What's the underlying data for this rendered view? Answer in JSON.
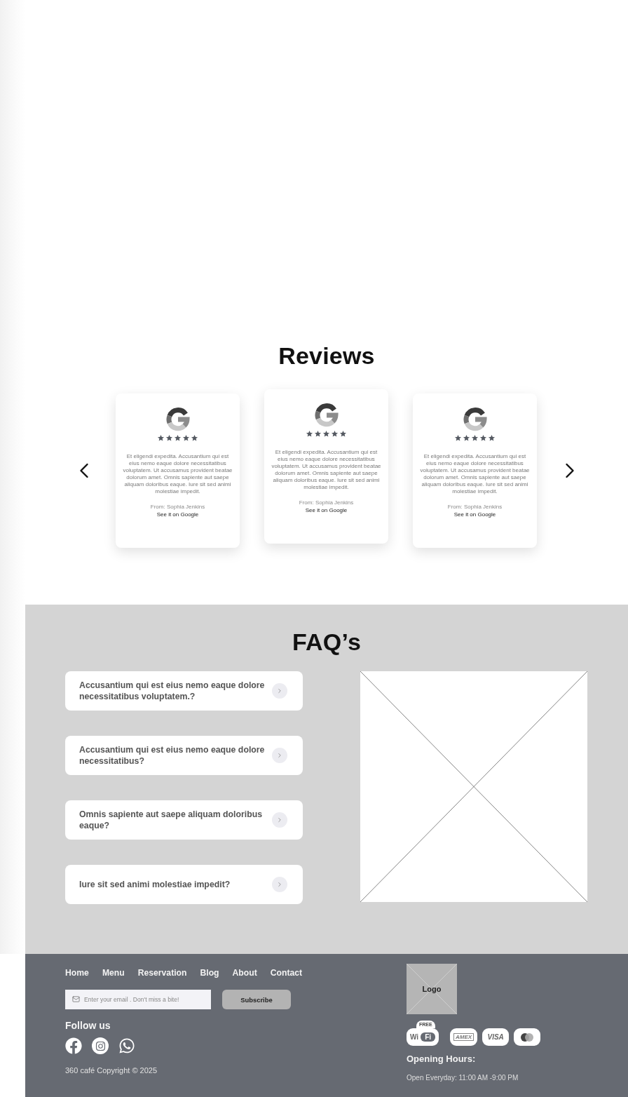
{
  "reviews": {
    "title": "Reviews",
    "cards": [
      {
        "stars": 5,
        "text": "Et eligendi expedita. Accusantium qui est eius nemo eaque dolore necessitatibus voluptatem. Ut accusamus provident beatae dolorum amet. Omnis sapiente aut saepe aliquam doloribus eaque. Iure sit sed animi molestiae impedit.",
        "author": "From: Sophia Jenkins",
        "link": "See it on Google"
      },
      {
        "stars": 5,
        "text": "Et eligendi expedita. Accusantium qui est eius nemo eaque dolore necessitatibus voluptatem. Ut accusamus provident beatae dolorum amet. Omnis sapiente aut saepe aliquam doloribus eaque. Iure sit sed animi molestiae impedit.",
        "author": "From: Sophia Jenkins",
        "link": "See it on Google"
      },
      {
        "stars": 5,
        "text": "Et eligendi expedita. Accusantium qui est eius nemo eaque dolore necessitatibus voluptatem. Ut accusamus provident beatae dolorum amet. Omnis sapiente aut saepe aliquam doloribus eaque. Iure sit sed animi molestiae impedit.",
        "author": "From: Sophia Jenkins",
        "link": "See it on Google"
      }
    ]
  },
  "faq": {
    "title": "FAQ’s",
    "items": [
      {
        "question": "Accusantium qui est eius nemo eaque dolore necessitatibus voluptatem.?"
      },
      {
        "question": "Accusantium qui est eius nemo eaque dolore necessitatibus?"
      },
      {
        "question": "Omnis sapiente aut saepe aliquam doloribus eaque?"
      },
      {
        "question": "Iure sit sed animi molestiae impedit?"
      }
    ]
  },
  "footer": {
    "nav": [
      "Home",
      "Menu",
      "Reservation",
      "Blog",
      "About",
      "Contact"
    ],
    "email": {
      "placeholder": "Enter your email . Don't miss a bite!"
    },
    "subscribe": "Subscribe",
    "follow_title": "Follow us",
    "copyright": "360 café Copyright © 2025",
    "logo": "Logo",
    "badges": [
      {
        "kind": "wifi",
        "top": "FREE",
        "left": "Wi",
        "right": "Fi"
      },
      {
        "kind": "card",
        "label": "AMEX"
      },
      {
        "kind": "card",
        "label": "VISA"
      },
      {
        "kind": "mastercard"
      }
    ],
    "hours_title": "Opening Hours:",
    "hours": "Open Everyday: 11:00 AM -9:00 PM"
  }
}
